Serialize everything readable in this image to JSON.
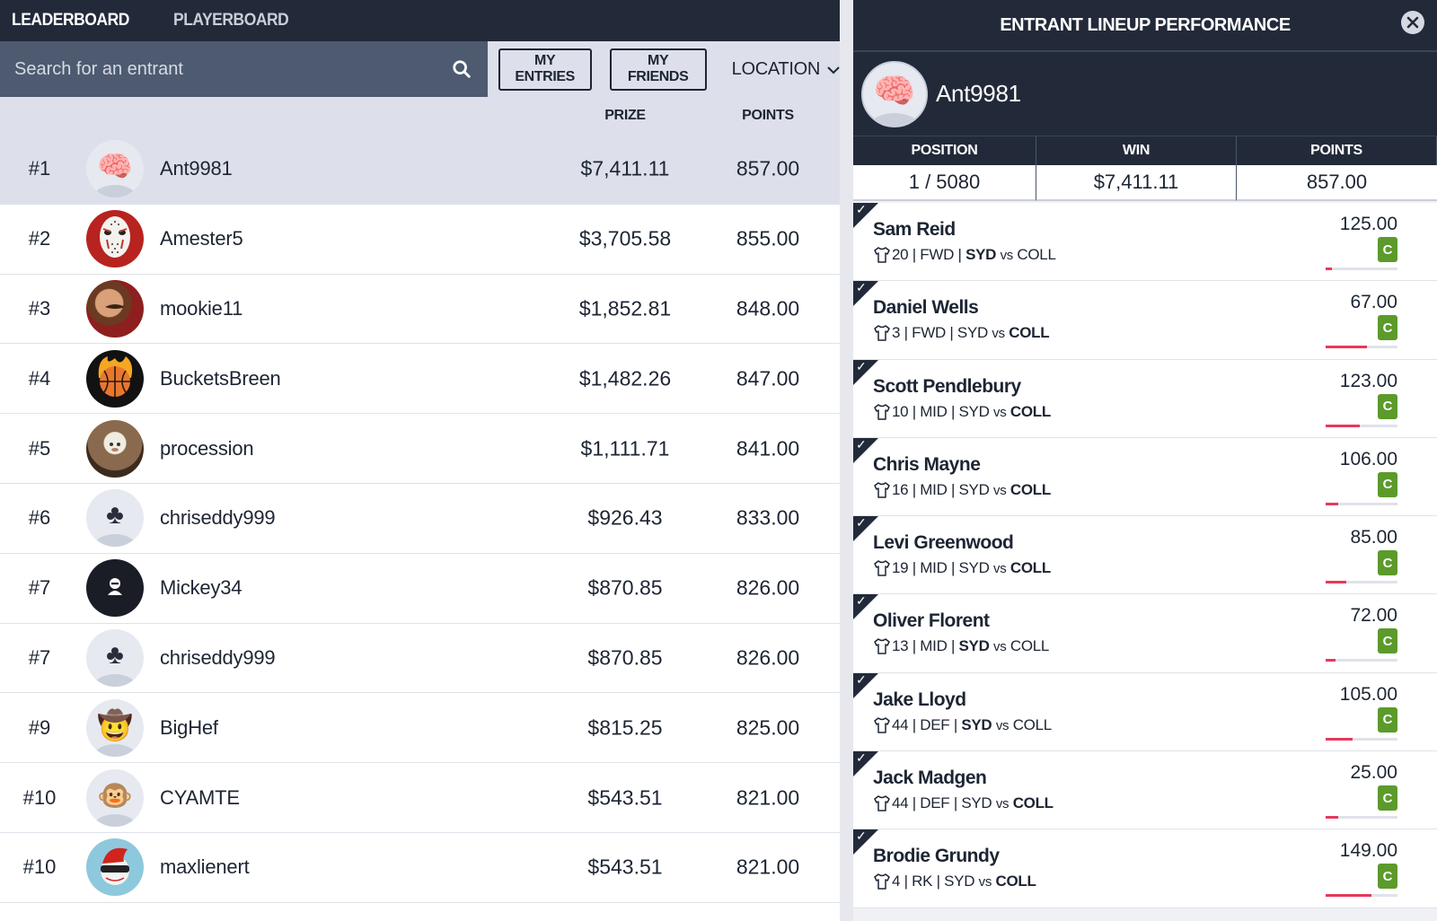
{
  "nav": {
    "tabs": [
      {
        "label": "LEADERBOARD",
        "active": true
      },
      {
        "label": "PLAYERBOARD",
        "active": false
      }
    ]
  },
  "filters": {
    "search_placeholder": "Search for an entrant",
    "search_value": "",
    "my_entries_label": "MY ENTRIES",
    "my_friends_label": "MY FRIENDS",
    "location_label": "LOCATION"
  },
  "columns": {
    "prize": "PRIZE",
    "points": "POINTS"
  },
  "leaderboard": [
    {
      "rank": "#1",
      "name": "Ant9981",
      "prize": "$7,411.11",
      "points": "857.00",
      "avatar": "brain-icon",
      "highlight": true
    },
    {
      "rank": "#2",
      "name": "Amester5",
      "prize": "$3,705.58",
      "points": "855.00",
      "avatar": "hockey-mask-icon"
    },
    {
      "rank": "#3",
      "name": "mookie11",
      "prize": "$1,852.81",
      "points": "848.00",
      "avatar": "photo-man-mustache"
    },
    {
      "rank": "#4",
      "name": "BucketsBreen",
      "prize": "$1,482.26",
      "points": "847.00",
      "avatar": "flaming-basketball-icon"
    },
    {
      "rank": "#5",
      "name": "procession",
      "prize": "$1,111.71",
      "points": "841.00",
      "avatar": "photo-monkey"
    },
    {
      "rank": "#6",
      "name": "chriseddy999",
      "prize": "$926.43",
      "points": "833.00",
      "avatar": "club-suit-icon"
    },
    {
      "rank": "#7",
      "name": "Mickey34",
      "prize": "$870.85",
      "points": "826.00",
      "avatar": "default-user-icon"
    },
    {
      "rank": "#7",
      "name": "chriseddy999",
      "prize": "$870.85",
      "points": "826.00",
      "avatar": "club-suit-icon"
    },
    {
      "rank": "#9",
      "name": "BigHef",
      "prize": "$815.25",
      "points": "825.00",
      "avatar": "cowboy-emoji-icon"
    },
    {
      "rank": "#10",
      "name": "CYAMTE",
      "prize": "$543.51",
      "points": "821.00",
      "avatar": "monkey-emoji-icon"
    },
    {
      "rank": "#10",
      "name": "maxlienert",
      "prize": "$543.51",
      "points": "821.00",
      "avatar": "mohawk-baseball-icon"
    }
  ],
  "panel": {
    "title": "ENTRANT LINEUP PERFORMANCE",
    "username": "Ant9981",
    "stats_headers": {
      "position": "POSITION",
      "win": "WIN",
      "points": "POINTS"
    },
    "stats_values": {
      "position": "1 / 5080",
      "win": "$7,411.11",
      "points": "857.00"
    },
    "captain_label": "C",
    "players": [
      {
        "name": "Sam Reid",
        "number": "20",
        "pos": "FWD",
        "home": "SYD",
        "vs": "vs",
        "away": "COLL",
        "bold_team": "home",
        "score": "125.00",
        "progress": 0.09
      },
      {
        "name": "Daniel Wells",
        "number": "3",
        "pos": "FWD",
        "home": "SYD",
        "vs": "vs",
        "away": "COLL",
        "bold_team": "away",
        "score": "67.00",
        "progress": 0.58
      },
      {
        "name": "Scott Pendlebury",
        "number": "10",
        "pos": "MID",
        "home": "SYD",
        "vs": "vs",
        "away": "COLL",
        "bold_team": "away",
        "score": "123.00",
        "progress": 0.47
      },
      {
        "name": "Chris Mayne",
        "number": "16",
        "pos": "MID",
        "home": "SYD",
        "vs": "vs",
        "away": "COLL",
        "bold_team": "away",
        "score": "106.00",
        "progress": 0.17
      },
      {
        "name": "Levi Greenwood",
        "number": "19",
        "pos": "MID",
        "home": "SYD",
        "vs": "vs",
        "away": "COLL",
        "bold_team": "away",
        "score": "85.00",
        "progress": 0.29
      },
      {
        "name": "Oliver Florent",
        "number": "13",
        "pos": "MID",
        "home": "SYD",
        "vs": "vs",
        "away": "COLL",
        "bold_team": "home",
        "score": "72.00",
        "progress": 0.14
      },
      {
        "name": "Jake Lloyd",
        "number": "44",
        "pos": "DEF",
        "home": "SYD",
        "vs": "vs",
        "away": "COLL",
        "bold_team": "home",
        "score": "105.00",
        "progress": 0.37
      },
      {
        "name": "Jack Madgen",
        "number": "44",
        "pos": "DEF",
        "home": "SYD",
        "vs": "vs",
        "away": "COLL",
        "bold_team": "away",
        "score": "25.00",
        "progress": 0.17
      },
      {
        "name": "Brodie Grundy",
        "number": "4",
        "pos": "RK",
        "home": "SYD",
        "vs": "vs",
        "away": "COLL",
        "bold_team": "away",
        "score": "149.00",
        "progress": 0.64
      }
    ]
  },
  "colors": {
    "nav_bg": "#222a3a",
    "search_bg": "#4d5a70",
    "highlight_row": "#dde0ea",
    "captain_badge": "#5c9a2b",
    "progress_fill": "#e8385c",
    "progress_track": "#dfe2ea"
  }
}
